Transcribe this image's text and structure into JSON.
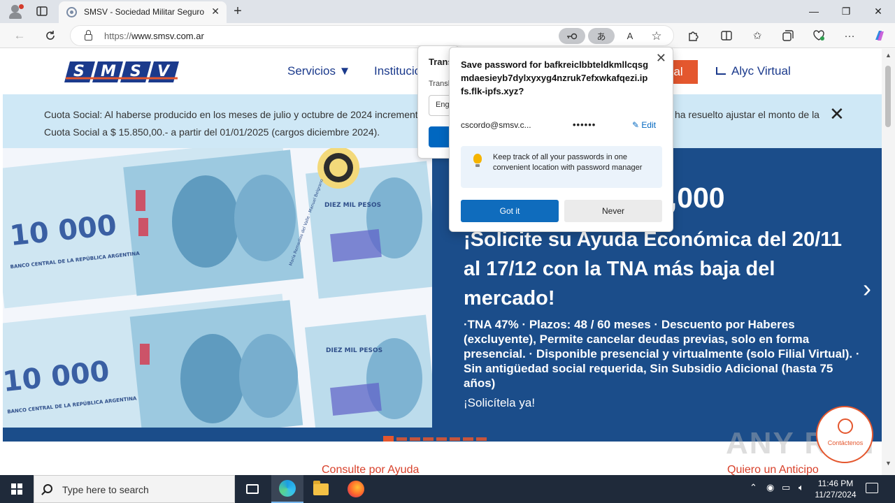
{
  "browser": {
    "tab_title": "SMSV - Sociedad Militar Seguro de Vida",
    "tab_close": "✕",
    "new_tab": "+",
    "url_prefix": "https://",
    "url_host": "www.smsv.com.ar",
    "window_minimize": "—",
    "window_maximize": "❐",
    "window_close": "✕"
  },
  "site": {
    "logo_text": "SMSV",
    "nav": {
      "servicios": "Servicios ▼",
      "institucional": "Institucional",
      "virtual": "ual",
      "alyc": "Alyc Virtual"
    },
    "notice": {
      "text": "Cuota Social: Al haberse producido en los meses de julio y octubre de 2024 incrementos en los haberes del personal militar, el Consejo Directivo ha resuelto ajustar el monto de la Cuota Social a $ 15.850,00.- a partir del 01/01/2025 (cargos diciembre 2024).",
      "close": "✕"
    },
    "hero": {
      "amount": "0,000",
      "title": "¡Solicite su Ayuda Económica del 20/11 al 17/12 con la TNA más baja del mercado!",
      "body": "·TNA 47% · Plazos: 48 / 60 meses · Descuento por Haberes (excluyente), Permite cancelar deudas previas, solo en forma presencial. · Disponible presencial y virtualmente (solo Filial Virtual). · Sin antigüedad social requerida, Sin Subsidio Adicional (hasta 75 años)",
      "cta": "¡Solicítela ya!",
      "next": "›",
      "banknote_value": "10 000",
      "banknote_words": "DIEZ MIL PESOS",
      "banknote_bank": "BANCO CENTRAL DE LA REPÚBLICA ARGENTINA",
      "banknote_names": "María Remedios del Valle · Manuel Belgrano"
    },
    "bottom_links": {
      "left": "Consulte por Ayuda",
      "right": "Quiero un Anticipo"
    },
    "contact_label": "Contáctenos",
    "watermark": "ANY RUN"
  },
  "translate_popup": {
    "title": "Translate",
    "subtitle": "Translate",
    "select_value": "English"
  },
  "password_popup": {
    "title": "Save password for bafkreiclbbteldkmllcqsgmdaesieyb7dylxyxyg4nzruk7efxwkafqezi.ipfs.flk-ipfs.xyz?",
    "username": "cscordo@smsv.c...",
    "password_mask": "••••••",
    "edit_label": "Edit",
    "tip": "Keep track of all your passwords in one convenient location with password manager",
    "got_it": "Got it",
    "never": "Never",
    "close": "✕"
  },
  "taskbar": {
    "search_placeholder": "Type here to search",
    "time": "11:46 PM",
    "date": "11/27/2024"
  },
  "colors": {
    "accent_orange": "#e4572e",
    "brand_blue": "#1b3a8c",
    "hero_blue": "#1b4d8a",
    "notice_bg": "#cfe8f6",
    "edge_blue": "#0f6cbd"
  }
}
